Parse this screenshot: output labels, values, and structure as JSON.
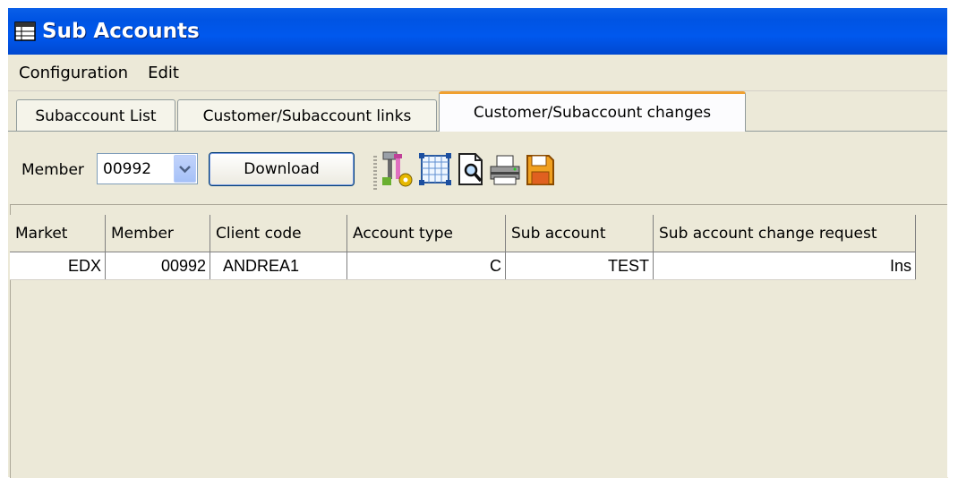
{
  "window": {
    "title": "Sub Accounts",
    "title_icon": "table-icon"
  },
  "menu": [
    "Configuration",
    "Edit"
  ],
  "tabs": [
    {
      "label": "Subaccount List",
      "active": false
    },
    {
      "label": "Customer/Subaccount links",
      "active": false
    },
    {
      "label": "Customer/Subaccount changes",
      "active": true
    }
  ],
  "toolbar": {
    "member_label": "Member",
    "member_value": "00992",
    "download_label": "Download",
    "icons": [
      "tools-icon",
      "grid-layout-icon",
      "print-preview-icon",
      "printer-icon",
      "export-icon"
    ]
  },
  "table": {
    "columns": [
      "Market",
      "Member",
      "Client code",
      "Account type",
      "Sub account",
      "Sub account change request"
    ],
    "rows": [
      [
        "EDX",
        "00992",
        "ANDREA1",
        "C",
        "TEST",
        "Ins"
      ]
    ]
  },
  "colors": {
    "titlebar": "#0054e3",
    "window_bg": "#ece9d8",
    "active_tab_accent": "#f0a030"
  }
}
